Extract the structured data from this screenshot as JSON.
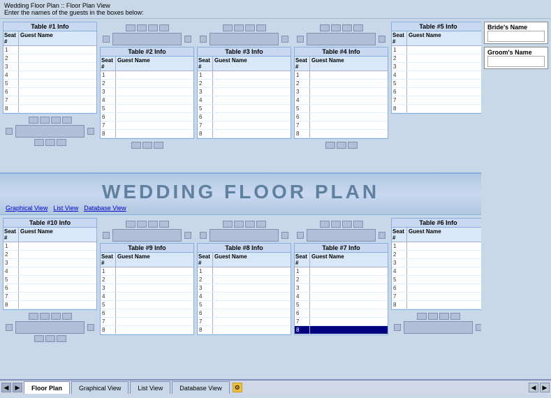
{
  "topbar": {
    "title": "Wedding Floor Plan :: Floor Plan View",
    "subtitle": "Enter the names of the guests in the boxes below:"
  },
  "rightPanel": {
    "brideLabel": "Bride's Name",
    "groomLabel": "Groom's Name"
  },
  "titleBanner": {
    "text": "WEDDING FLOOR PLAN"
  },
  "navLinks": [
    {
      "label": "Graphical View",
      "key": "graphical"
    },
    {
      "label": "List View",
      "key": "list"
    },
    {
      "label": "Database View",
      "key": "database"
    }
  ],
  "tabs": [
    {
      "label": "Floor Plan",
      "active": true
    },
    {
      "label": "Graphical View",
      "active": false
    },
    {
      "label": "List View",
      "active": false
    },
    {
      "label": "Database View",
      "active": false
    }
  ],
  "tables": {
    "upper": [
      {
        "id": "t1",
        "title": "Table #1 Info",
        "colSeat": "Seat #",
        "colGuest": "Guest Name",
        "rows": [
          1,
          2,
          3,
          4,
          5,
          6,
          7,
          8
        ]
      },
      {
        "id": "t2",
        "title": "Table #2 Info",
        "colSeat": "Seat #",
        "colGuest": "Guest Name",
        "rows": [
          1,
          2,
          3,
          4,
          5,
          6,
          7,
          8
        ]
      },
      {
        "id": "t3",
        "title": "Table #3 Info",
        "colSeat": "Seat #",
        "colGuest": "Guest Name",
        "rows": [
          1,
          2,
          3,
          4,
          5,
          6,
          7,
          8
        ]
      },
      {
        "id": "t4",
        "title": "Table #4 Info",
        "colSeat": "Seat #",
        "colGuest": "Guest Name",
        "rows": [
          1,
          2,
          3,
          4,
          5,
          6,
          7,
          8
        ]
      },
      {
        "id": "t5",
        "title": "Table #5 Info",
        "colSeat": "Seat #",
        "colGuest": "Guest Name",
        "rows": [
          1,
          2,
          3,
          4,
          5,
          6,
          7,
          8
        ]
      }
    ],
    "lower": [
      {
        "id": "t10",
        "title": "Table #10 Info",
        "colSeat": "Seat #",
        "colGuest": "Guest Name",
        "rows": [
          1,
          2,
          3,
          4,
          5,
          6,
          7,
          8
        ]
      },
      {
        "id": "t9",
        "title": "Table #9 Info",
        "colSeat": "Seat #",
        "colGuest": "Guest Name",
        "rows": [
          1,
          2,
          3,
          4,
          5,
          6,
          7,
          8
        ]
      },
      {
        "id": "t8",
        "title": "Table #8 Info",
        "colSeat": "Seat #",
        "colGuest": "Guest Name",
        "rows": [
          1,
          2,
          3,
          4,
          5,
          6,
          7,
          8
        ]
      },
      {
        "id": "t7",
        "title": "Table #7 Info",
        "colSeat": "Seat #",
        "colGuest": "Guest Name",
        "rows": [
          1,
          2,
          3,
          4,
          5,
          6,
          7,
          8
        ]
      },
      {
        "id": "t6",
        "title": "Table #6 Info",
        "colSeat": "Seat #",
        "colGuest": "Guest Name",
        "rows": [
          1,
          2,
          3,
          4,
          5,
          6,
          7,
          8
        ]
      }
    ]
  }
}
